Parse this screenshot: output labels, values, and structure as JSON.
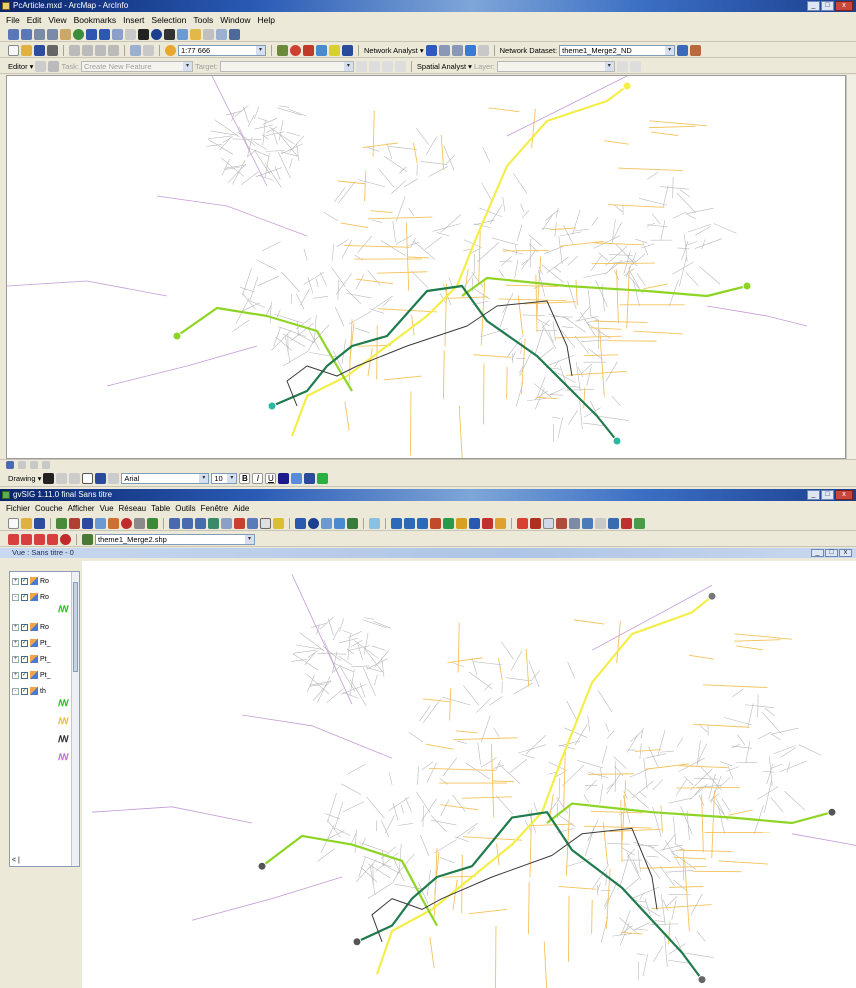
{
  "arcmap": {
    "title": "PcArticle.mxd - ArcMap - ArcInfo",
    "menu": [
      "File",
      "Edit",
      "View",
      "Bookmarks",
      "Insert",
      "Selection",
      "Tools",
      "Window",
      "Help"
    ],
    "scale": "1:77 666",
    "network_analyst_label": "Network Analyst ▾",
    "network_dataset_label": "Network Dataset:",
    "network_dataset_value": "theme1_Merge2_ND",
    "editor_label": "Editor ▾",
    "task_label": "Task:",
    "task_value": "Create New Feature",
    "target_label": "Target:",
    "spatial_analyst_label": "Spatial Analyst ▾",
    "layer_label": "Layer:",
    "drawing_label": "Drawing ▾",
    "font_value": "Arial",
    "font_size": "10"
  },
  "gvsig": {
    "title": "gvSIG 1.11.0 final Sans titre",
    "menu": [
      "Fichier",
      "Couche",
      "Afficher",
      "Vue",
      "Réseau",
      "Table",
      "Outils",
      "Fenêtre",
      "Aide"
    ],
    "layer_combo": "theme1_Merge2.shp",
    "view_title": "Vue : Sans titre - 0",
    "toc_layers": [
      "Ro",
      "Ro",
      "Ro",
      "Pt_",
      "Pt_",
      "Pt_",
      "th"
    ],
    "scroll_label": "< |"
  },
  "colors": {
    "yellow_route": "#f4ee4a",
    "light_green_route": "#8ed424",
    "dark_green_route": "#1f7a4c",
    "dark_line": "#3a3a3a",
    "road_orange": "#f4c25a",
    "road_gray": "#b9b9b9",
    "road_purple": "#c49ad8"
  }
}
